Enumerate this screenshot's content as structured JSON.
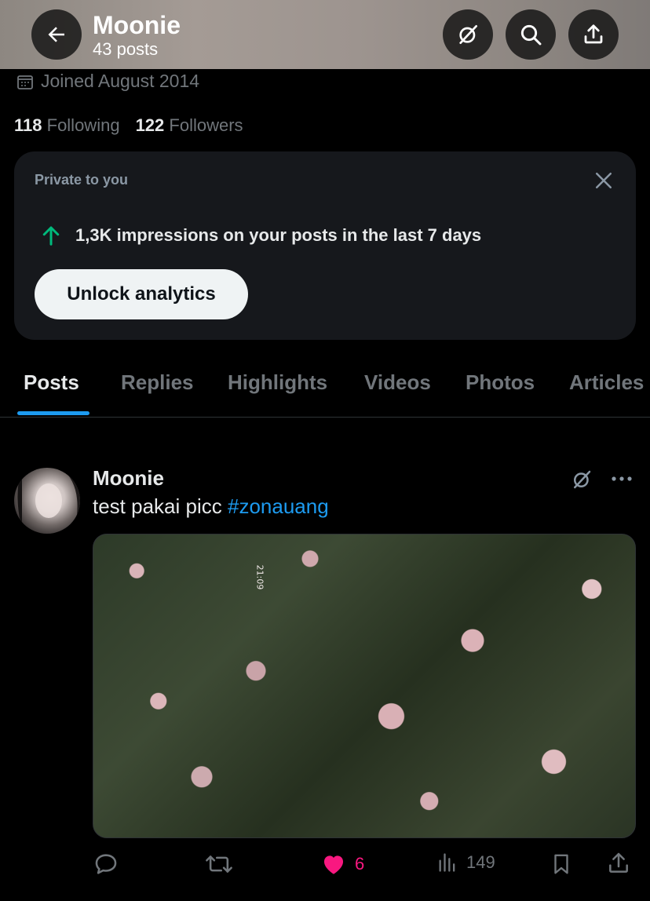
{
  "header": {
    "name": "Moonie",
    "posts": "43 posts",
    "back_icon": "arrow-left-icon",
    "grok_icon": "grok-icon",
    "search_icon": "search-icon",
    "share_icon": "share-icon"
  },
  "profile": {
    "joined": "Joined August 2014",
    "following_count": "118",
    "following_label": "Following",
    "followers_count": "122",
    "followers_label": "Followers"
  },
  "analytics_card": {
    "label": "Private to you",
    "stat": "1,3K impressions on your posts in the last 7 days",
    "button": "Unlock analytics",
    "accent_color": "#00ba7c"
  },
  "tabs": [
    {
      "label": "Posts",
      "active": true
    },
    {
      "label": "Replies"
    },
    {
      "label": "Highlights"
    },
    {
      "label": "Videos"
    },
    {
      "label": "Photos"
    },
    {
      "label": "Articles"
    }
  ],
  "post": {
    "author": "Moonie",
    "text": "test pakai picc ",
    "hashtag": "#zonauang",
    "media_stamp": "21:09",
    "actions": {
      "reply_count": "",
      "repost_count": "",
      "like_count": "6",
      "views_count": "149"
    }
  },
  "colors": {
    "link": "#1d9bf0",
    "like": "#f91880",
    "muted": "#71767b"
  }
}
